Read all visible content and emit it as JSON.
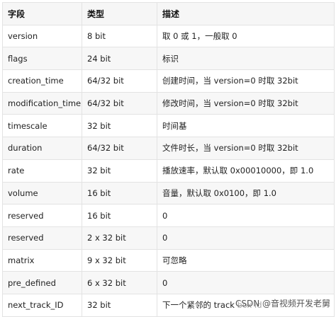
{
  "table": {
    "headers": [
      "字段",
      "类型",
      "描述"
    ],
    "rows": [
      [
        "version",
        "8 bit",
        "取 0 或 1，一般取 0"
      ],
      [
        "flags",
        "24 bit",
        "标识"
      ],
      [
        "creation_time",
        "64/32 bit",
        "创建时间，当 version=0 时取 32bit"
      ],
      [
        "modification_time",
        "64/32 bit",
        "修改时间，当 version=0 时取 32bit"
      ],
      [
        "timescale",
        "32 bit",
        "时间基"
      ],
      [
        "duration",
        "64/32 bit",
        "文件时长，当 version=0 时取 32bit"
      ],
      [
        "rate",
        "32 bit",
        "播放速率，默认取 0x00010000，即 1.0"
      ],
      [
        "volume",
        "16 bit",
        "音量，默认取 0x0100，即 1.0"
      ],
      [
        "reserved",
        "16 bit",
        "0"
      ],
      [
        "reserved",
        "2 x 32 bit",
        "0"
      ],
      [
        "matrix",
        "9 x 32 bit",
        "可忽略"
      ],
      [
        "pre_defined",
        "6 x 32 bit",
        "0"
      ],
      [
        "next_track_ID",
        "32 bit",
        "下一个紧邻的 track box id"
      ]
    ]
  },
  "caption": "CSDN @音视频开发老舅"
}
